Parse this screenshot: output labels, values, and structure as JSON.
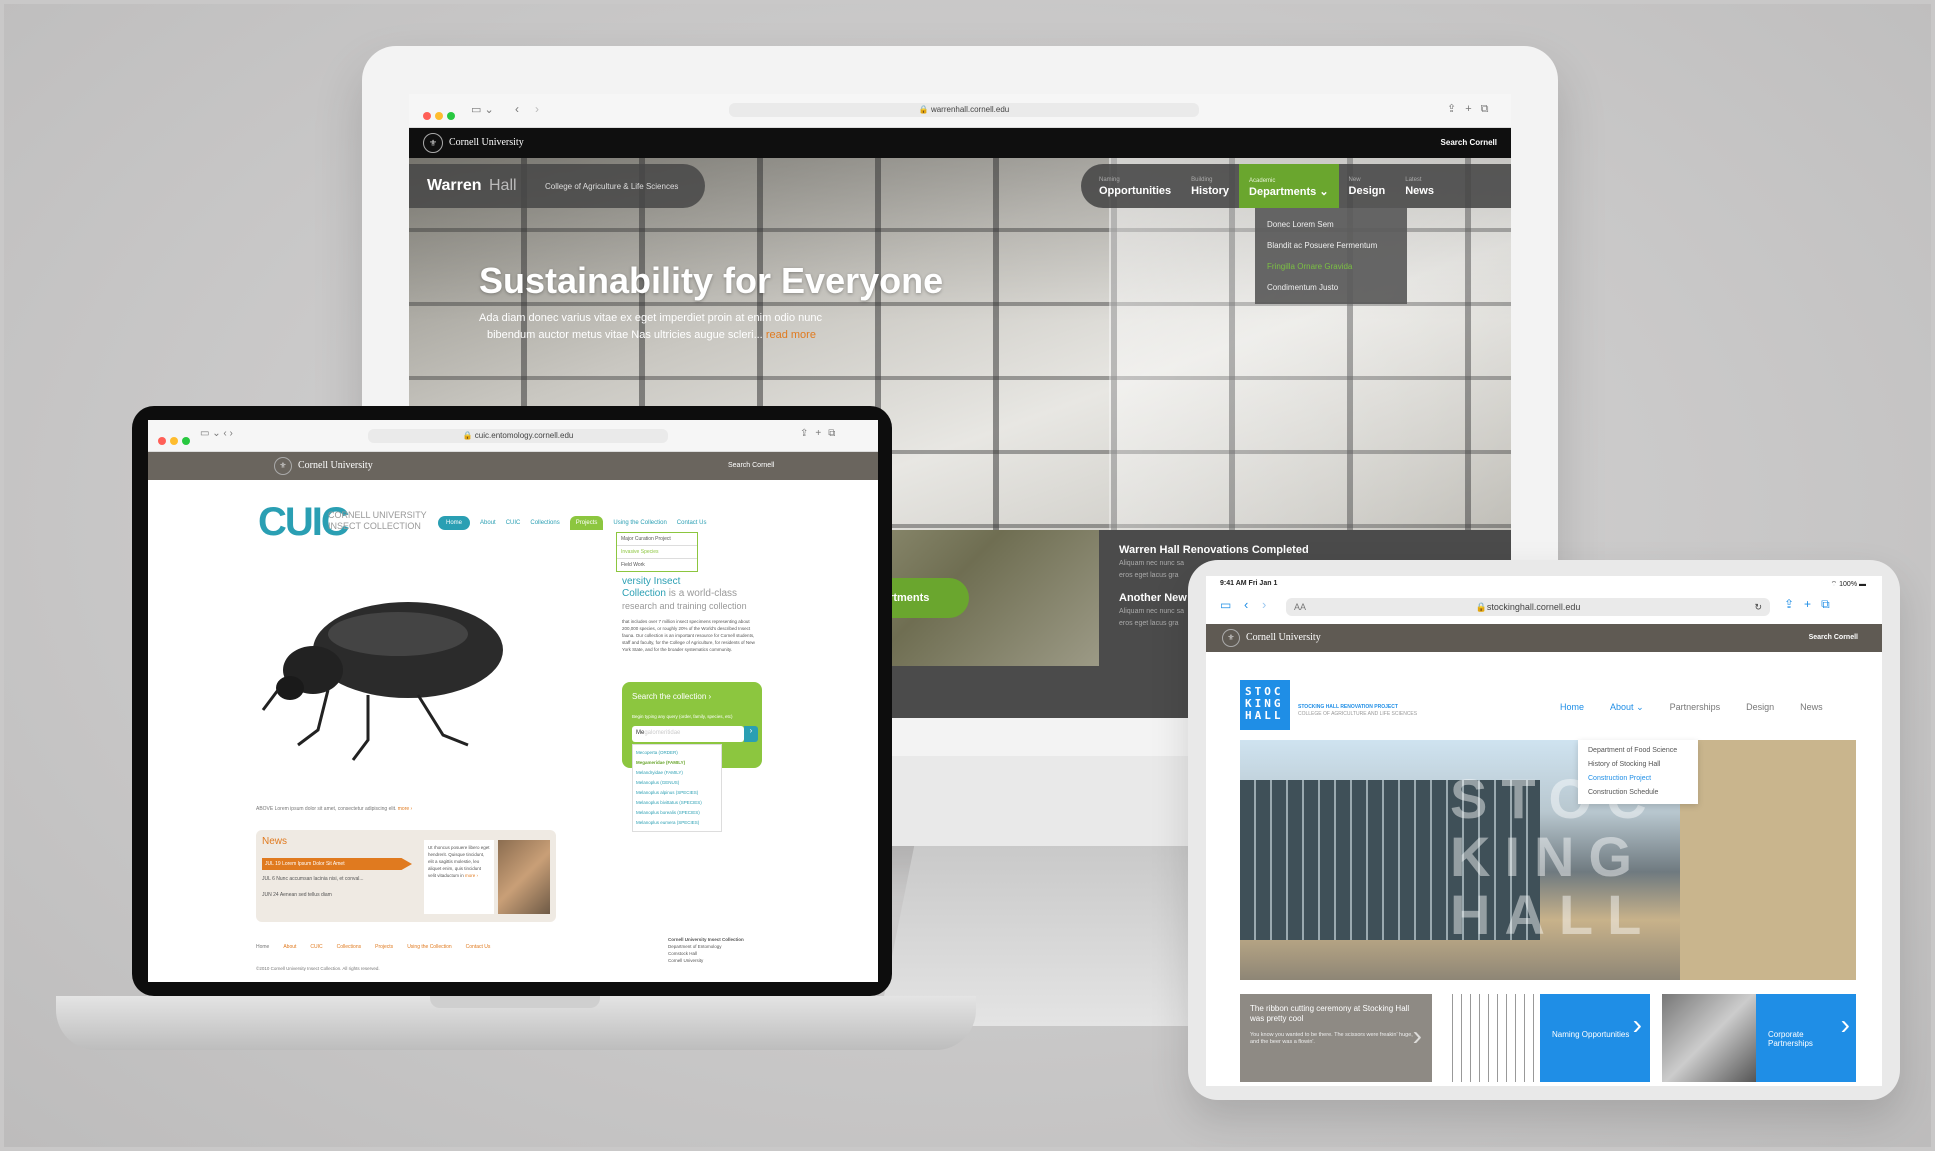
{
  "imac": {
    "url": "warrenhall.cornell.edu",
    "cornell_label": "Cornell University",
    "search_label": "Search Cornell",
    "site_logo_bold": "Warren",
    "site_logo_light": "Hall",
    "college": "College of Agriculture & Life Sciences",
    "nav": [
      {
        "small": "Naming",
        "label": "Opportunities"
      },
      {
        "small": "Building",
        "label": "History"
      },
      {
        "small": "Academic",
        "label": "Departments"
      },
      {
        "small": "New",
        "label": "Design"
      },
      {
        "small": "Latest",
        "label": "News"
      }
    ],
    "dropdown": [
      "Donec Lorem Sem",
      "Blandit ac Posuere Fermentum",
      "Fringilla Ornare Gravida",
      "Condimentum Justo"
    ],
    "hero_title": "Sustainability for Everyone",
    "hero_text_1": "Ada diam donec varius vitae ex eget imperdiet proin at enim odio nunc",
    "hero_text_2": "bibendum auctor metus vitae Nas ultricies augue scleri...",
    "hero_more": "read more",
    "dept_button": "c Departments",
    "news_1_title": "Warren Hall Renovations Completed",
    "news_text": "Aliquam nec nunc sa",
    "news_text_2": "eros eget lacus gra",
    "news_2_title": "Another New"
  },
  "laptop": {
    "url": "cuic.entomology.cornell.edu",
    "cornell_label": "Cornell University",
    "search_label": "Search Cornell",
    "logo_text": "CUIC",
    "logo_line_1": "CORNELL UNIVERSITY",
    "logo_line_2": "INSECT COLLECTION",
    "nav": [
      "Home",
      "About",
      "CUIC",
      "Collections",
      "Projects",
      "Using the Collection",
      "Contact Us"
    ],
    "projects_menu": [
      "Major Curation Project",
      "Invasive Species",
      "Field Work"
    ],
    "intro_title_1": "versity Insect",
    "intro_title_2": "Collection",
    "intro_title_3": "is a world-class",
    "intro_title_4": "research and training collection",
    "intro_body": "that includes over 7 million insect specimens representing about 200,000 species, or roughly 20% of the World's described Insect fauna. Our collection is an important resource for Cornell students, staff and faculty, for the College of Agriculture, for residents of New York State, and for the broader systematics community.",
    "search_title": "Search the collection ›",
    "search_hint": "Begin typing any query (order, family, species, etc)",
    "search_value": "Me",
    "search_placeholder": "galomeritidae",
    "suggestions": [
      "Mecoperta (ORDER)",
      "Megameridae (FAMILY)",
      "Melandryidae (FAMILY)",
      "Melanoplus (GENUS)",
      "Melanoplus alpinus (SPECIES)",
      "Melanoplus bivittatus (SPECIES)",
      "Melanoplus borealis (SPECIES)",
      "Melanoplus eumera (SPECIES)"
    ],
    "caption_label": "ABOVE",
    "caption": "Lorem ipsum dolor sit amet, consectetur adipiscing elit.",
    "caption_more": "more ›",
    "news_title": "News",
    "news_items": [
      {
        "date": "JUL 19",
        "text": "Lorem Ipsum Dolor Sit Amet"
      },
      {
        "date": "JUL 6",
        "text": "Nunc accumsan lacinia nisi, et conval..."
      },
      {
        "date": "JUN 24",
        "text": "Aenean sed tellus diam"
      }
    ],
    "news_body": "Ut rhoncus posuere libero eget hendrerit. Quisque tincidunt, elit a sagittis molestie, leo aliquet enim, quis tincidunt velit vitaductum in",
    "news_more": "more ›",
    "footer_nav": [
      "Home",
      "About",
      "CUIC",
      "Collections",
      "Projects",
      "Using the Collection",
      "Contact Us"
    ],
    "footer_address": [
      "Cornell University Insect Collection",
      "Department of Entomology",
      "Comstock Hall",
      "Cornell University"
    ],
    "copyright": "©2010 Cornell University Insect Collection. All rights reserved."
  },
  "ipad": {
    "time": "9:41 AM",
    "date": "Fri Jan 1",
    "battery": "100%",
    "url": "stockinghall.cornell.edu",
    "aa": "AA",
    "cornell_label": "Cornell University",
    "search_label": "Search Cornell",
    "logo": "STOCKINGHALL",
    "project_title": "STOCKING HALL RENOVATION PROJECT",
    "college": "COLLEGE OF AGRICULTURE AND LIFE SCIENCES",
    "nav": [
      "Home",
      "About",
      "Partnerships",
      "Design",
      "News"
    ],
    "about_menu": [
      "Department of Food Science",
      "History of Stocking Hall",
      "Construction Project",
      "Construction Schedule"
    ],
    "building_letters": "STOCKINGHALL",
    "tiles": [
      {
        "title": "The ribbon cutting ceremony at Stocking Hall was pretty cool",
        "body": "You know you wanted to be there. The scissors were freakin' huge, and the beer was a flowin'."
      },
      {
        "title": "Naming Opportunities"
      },
      {
        "title": "Corporate Partnerships"
      }
    ]
  },
  "colors": {
    "cuic_teal": "#2a9fb3",
    "cuic_green": "#8cc63f",
    "warren_green": "#6aa62e",
    "stocking_blue": "#1f8ee6",
    "news_orange": "#e07a1f"
  }
}
